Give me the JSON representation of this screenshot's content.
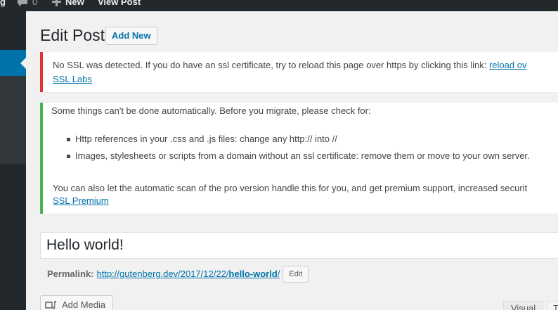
{
  "admin_bar": {
    "site_fragment": "g",
    "comments_count": "0",
    "new_label": "New",
    "view_post_label": "View Post"
  },
  "header": {
    "title": "Edit Post",
    "add_new_label": "Add New"
  },
  "notices": {
    "ssl": {
      "text": "No SSL was detected. If you do have an ssl certificate, try to reload this page over https by clicking this link: ",
      "link_text": "reload ov",
      "link2_text": "SSL Labs"
    },
    "migrate": {
      "intro": "Some things can't be done automatically. Before you migrate, please check for:",
      "items": [
        "Http references in your .css and .js files: change any http:// into //",
        "Images, stylesheets or scripts from a domain without an ssl certificate: remove them or move to your own server."
      ],
      "outro": "You can also let the automatic scan of the pro version handle this for you, and get premium support, increased securit",
      "premium_link": "SSL Premium"
    },
    "colors": {
      "error": "#dc3232",
      "success": "#46b450"
    }
  },
  "post": {
    "title_value": "Hello world!",
    "permalink_label": "Permalink:",
    "permalink_base": "http://gutenberg.dev/2017/12/22/",
    "permalink_slug": "hello-world",
    "permalink_trailing": "/",
    "edit_label": "Edit"
  },
  "editor": {
    "add_media_label": "Add Media",
    "tab_visual": "Visual",
    "tab_text": "Text"
  },
  "icons": {
    "comments": "speech-bubble-icon",
    "new": "plus-icon",
    "media": "media-icon"
  }
}
